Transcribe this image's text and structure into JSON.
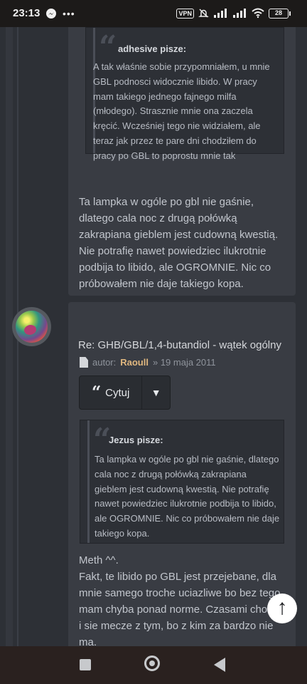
{
  "statusbar": {
    "time": "23:13",
    "vpn": "VPN",
    "battery": "28"
  },
  "post1": {
    "quote": {
      "author": "adhesive pisze:",
      "lines": [
        "A tak właśnie sobie przypomniałem, u mnie",
        "GBL podnosci widocznie libido. W pracy",
        "mam takiego jednego fajnego milfa",
        "(młodego). Strasznie mnie ona zaczela",
        "kręcić. Wcześniej tego nie widziałem, ale",
        "teraz jak przez te pare dni chodziłem do",
        "pracy po GBL to poprostu mnie tak"
      ]
    },
    "body": [
      "Ta lampka w ogóle po gbl nie gaśnie,",
      "dlatego cala noc z drugą połówką",
      "zakrapiana gieblem jest cudowną kwestią.",
      "Nie potrafię nawet powiedziec ilukrotnie",
      "podbija to libido, ale OGROMNIE. Nic co",
      "próbowałem nie daje takiego kopa."
    ]
  },
  "post2": {
    "title": "Re: GHB/GBL/1,4-butandiol - wątek ogólny",
    "author_prefix": "autor:",
    "author": "Raoull",
    "date": "» 19 maja 2011",
    "cytuj_label": "Cytuj",
    "quote": {
      "author": "Jezus pisze:",
      "lines": [
        "Ta lampka w ogóle po gbl nie gaśnie, dlatego",
        "cala noc z drugą połówką zakrapiana",
        "gieblem jest cudowną kwestią. Nie potrafię",
        "nawet powiedziec ilukrotnie podbija to libido,",
        "ale OGROMNIE. Nic co próbowałem nie daje",
        "takiego kopa."
      ]
    },
    "body": [
      "Meth ^^.",
      "Fakt, te libido po GBL jest przejebane, dla",
      "mnie samego troche uciazliwe bo bez tego",
      "mam chyba ponad norme. Czasami chodze",
      "i sie mecze z tym, bo z kim za bardzo nie",
      "ma."
    ]
  },
  "icons": {
    "messenger": "messenger-icon",
    "more": "more-icon",
    "silent": "silent-bell-icon",
    "signal": "signal-icon",
    "wifi": "wifi-icon",
    "scroll_up": "arrow-up-icon",
    "nav_recent": "recent-apps-icon",
    "nav_home": "home-icon",
    "nav_back": "back-icon"
  }
}
